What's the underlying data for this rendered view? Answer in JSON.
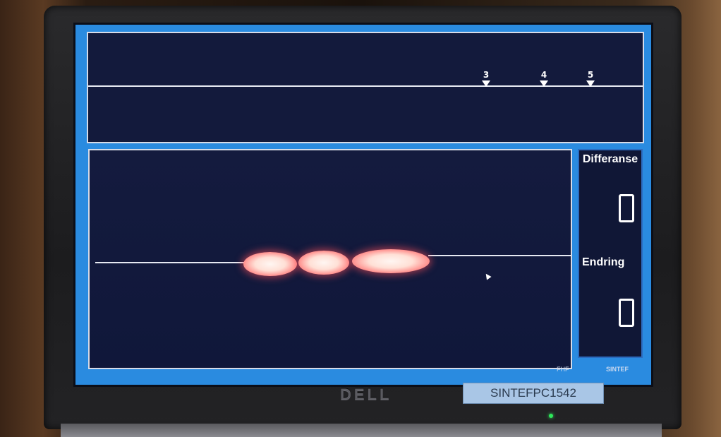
{
  "top_chart": {
    "markers": [
      "3",
      "4",
      "5"
    ]
  },
  "side_panel": {
    "difference_label": "Differanse",
    "difference_value": "0",
    "change_label": "Endring",
    "change_value": "0"
  },
  "footer": {
    "logo_left": "FHF",
    "logo_right": "SINTEF"
  },
  "hardware": {
    "brand": "DELL",
    "asset_label": "SINTEFPC1542"
  }
}
